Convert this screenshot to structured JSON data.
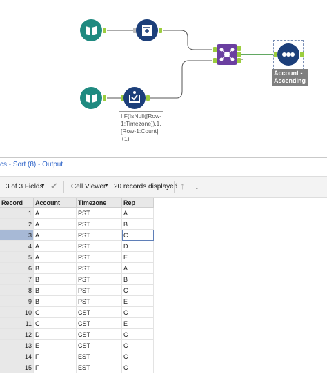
{
  "canvas": {
    "formula_annotation": "IIF(IsNull([Row-\n1:Timezone]),1,\n[Row-1:Count]\n+1)",
    "sort_annotation": "Account -\nAscending"
  },
  "results": {
    "title": "cs - Sort (8) - Output",
    "fields_label": "3 of 3 Fields",
    "cell_viewer_label": "Cell Viewer",
    "records_label": "20 records displayed",
    "columns": [
      "Record",
      "Account",
      "Timezone",
      "Rep"
    ],
    "rows": [
      [
        "1",
        "A",
        "PST",
        "A"
      ],
      [
        "2",
        "A",
        "PST",
        "B"
      ],
      [
        "3",
        "A",
        "PST",
        "C"
      ],
      [
        "4",
        "A",
        "PST",
        "D"
      ],
      [
        "5",
        "A",
        "PST",
        "E"
      ],
      [
        "6",
        "B",
        "PST",
        "A"
      ],
      [
        "7",
        "B",
        "PST",
        "B"
      ],
      [
        "8",
        "B",
        "PST",
        "C"
      ],
      [
        "9",
        "B",
        "PST",
        "E"
      ],
      [
        "10",
        "C",
        "CST",
        "C"
      ],
      [
        "11",
        "C",
        "CST",
        "E"
      ],
      [
        "12",
        "D",
        "CST",
        "C"
      ],
      [
        "13",
        "E",
        "CST",
        "C"
      ],
      [
        "14",
        "F",
        "EST",
        "C"
      ],
      [
        "15",
        "F",
        "EST",
        "C"
      ]
    ]
  }
}
